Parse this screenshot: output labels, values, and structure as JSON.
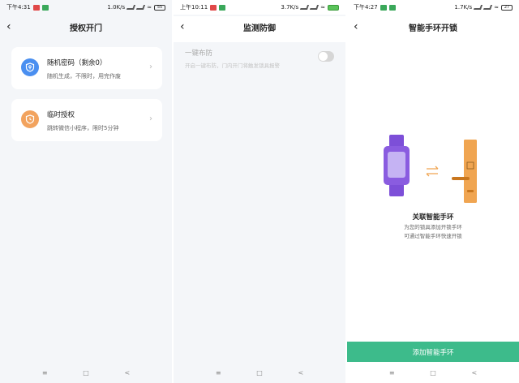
{
  "screens": [
    {
      "status": {
        "time": "下午4:31",
        "speed": "1.0K/s",
        "battery": "55"
      },
      "title": "授权开门",
      "cards": [
        {
          "name": "随机密码（剩余0）",
          "desc": "随机生成，不限时，用完作废",
          "icon": "shield-key-icon",
          "color": "#4a8ff0"
        },
        {
          "name": "临时授权",
          "desc": "跳转微信小程序，限时5分钟",
          "icon": "shield-clock-icon",
          "color": "#f2a35e"
        }
      ]
    },
    {
      "status": {
        "time": "上午10:11",
        "speed": "3.7K/s",
        "battery": ""
      },
      "title": "监测防御",
      "setting": {
        "label": "一键布防",
        "sub": "开启一键布防，门内开门将触发锁具报警"
      }
    },
    {
      "status": {
        "time": "下午4:27",
        "speed": "1.7K/s",
        "battery": "27"
      },
      "title": "智能手环开锁",
      "assoc_title": "关联智能手环",
      "assoc_line1": "为您的锁具添加开锁手环",
      "assoc_line2": "可通过智能手环快速开锁",
      "button": "添加智能手环"
    }
  ],
  "nav": {
    "menu": "≡",
    "home": "□",
    "back": "<"
  },
  "colors": {
    "accent": "#3dbb8b",
    "band": "#8a5ce0",
    "lock": "#f0a551"
  }
}
